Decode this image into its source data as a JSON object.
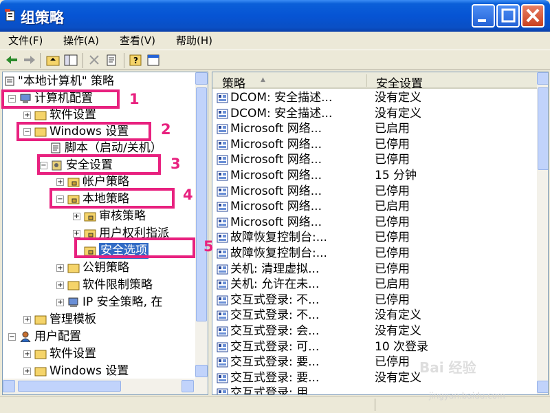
{
  "window": {
    "title": "组策略"
  },
  "menu": {
    "file": "文件(F)",
    "action": "操作(A)",
    "view": "查看(V)",
    "help": "帮助(H)"
  },
  "toolbar": [
    "back-icon",
    "forward-icon",
    "up-folder-icon",
    "show-tree-icon",
    "delete-icon",
    "properties-icon",
    "help-icon",
    "console-icon"
  ],
  "tree": {
    "root": "\"本地计算机\" 策略",
    "nodes": [
      "计算机配置",
      "软件设置",
      "Windows 设置",
      "脚本（启动/关机）",
      "安全设置",
      "帐户策略",
      "本地策略",
      "审核策略",
      "用户权利指派",
      "安全选项",
      "公钥策略",
      "软件限制策略",
      "IP 安全策略, 在",
      "管理模板",
      "用户配置",
      "软件设置",
      "Windows 设置"
    ]
  },
  "list": {
    "columns": {
      "policy": "策略",
      "setting": "安全设置"
    },
    "rows": [
      [
        "DCOM: 安全描述...",
        "没有定义"
      ],
      [
        "DCOM: 安全描述...",
        "没有定义"
      ],
      [
        "Microsoft 网络...",
        "已启用"
      ],
      [
        "Microsoft 网络...",
        "已停用"
      ],
      [
        "Microsoft 网络...",
        "已停用"
      ],
      [
        "Microsoft 网络...",
        "15 分钟"
      ],
      [
        "Microsoft 网络...",
        "已停用"
      ],
      [
        "Microsoft 网络...",
        "已启用"
      ],
      [
        "Microsoft 网络...",
        "已停用"
      ],
      [
        "故障恢复控制台:...",
        "已停用"
      ],
      [
        "故障恢复控制台:...",
        "已停用"
      ],
      [
        "关机: 清理虚拟...",
        "已停用"
      ],
      [
        "关机: 允许在未...",
        "已启用"
      ],
      [
        "交互式登录: 不...",
        "已停用"
      ],
      [
        "交互式登录: 不...",
        "没有定义"
      ],
      [
        "交互式登录: 会...",
        "没有定义"
      ],
      [
        "交互式登录: 可...",
        "10 次登录"
      ],
      [
        "交互式登录: 要...",
        "已停用"
      ],
      [
        "交互式登录: 要...",
        "没有定义"
      ],
      [
        "交互式登录: 用...",
        ""
      ]
    ]
  },
  "annotations": [
    "1",
    "2",
    "3",
    "4",
    "5"
  ],
  "watermark": {
    "main": "Bai 经验",
    "sub": "jingyan.baidu.com"
  },
  "colors": {
    "titlebar": "#0654d4",
    "annotation": "#e8217f",
    "selection": "#316ac5"
  }
}
